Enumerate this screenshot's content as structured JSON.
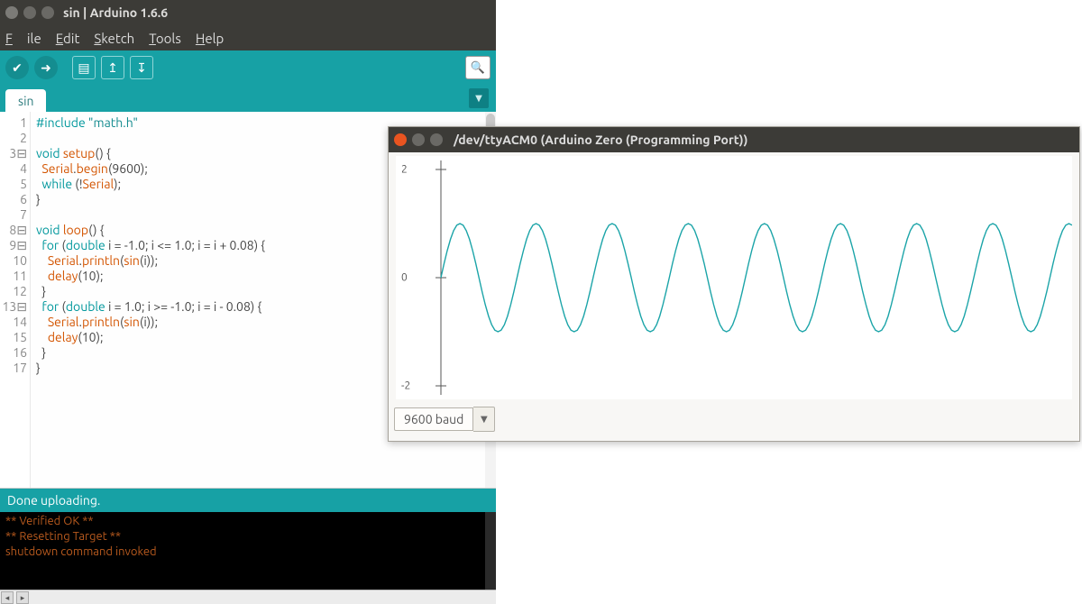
{
  "ide": {
    "title": "sin | Arduino 1.6.6",
    "menu": {
      "file": "File",
      "edit": "Edit",
      "sketch": "Sketch",
      "tools": "Tools",
      "help": "Help"
    },
    "icons": {
      "verify": "✔",
      "upload": "➜",
      "new": "▤",
      "open": "↥",
      "save": "↧",
      "serial": "🔍"
    },
    "tab_label": "sin",
    "gutter": [
      "1",
      "2",
      "3⊟",
      "4",
      "5",
      "6",
      "7",
      "8⊟",
      "9⊟",
      "10",
      "11",
      "12",
      "13⊟",
      "14",
      "15",
      "16",
      "17"
    ],
    "status": "Done uploading.",
    "console": [
      "** Verified OK **",
      "** Resetting Target **",
      "shutdown command invoked"
    ]
  },
  "plotter": {
    "title": "/dev/ttyACM0 (Arduino Zero (Programming Port))",
    "baud": "9600 baud"
  },
  "chart_data": {
    "type": "line",
    "title": "",
    "xlabel": "",
    "ylabel": "",
    "ylim": [
      -2.0,
      2.0
    ],
    "yticks": [
      2.0,
      0.0,
      -2.0
    ],
    "x": [
      0,
      1,
      2,
      3,
      4,
      5,
      6,
      7,
      8,
      9,
      10,
      11,
      12,
      13,
      14,
      15,
      16,
      17,
      18,
      19,
      20,
      21,
      22,
      23,
      24,
      25,
      26,
      27,
      28,
      29,
      30,
      31,
      32,
      33,
      34,
      35,
      36,
      37,
      38,
      39,
      40,
      41,
      42,
      43,
      44,
      45,
      46,
      47,
      48,
      49,
      50,
      51,
      52,
      53,
      54,
      55,
      56,
      57,
      58,
      59,
      60,
      61,
      62,
      63,
      64,
      65,
      66,
      67,
      68,
      69,
      70,
      71,
      72,
      73,
      74,
      75,
      76,
      77,
      78,
      79,
      80,
      81,
      82,
      83,
      84,
      85,
      86,
      87,
      88,
      89,
      90,
      91,
      92,
      93,
      94,
      95,
      96,
      97,
      98,
      99,
      100,
      101,
      102,
      103,
      104,
      105,
      106,
      107,
      108,
      109,
      110,
      111,
      112,
      113,
      114,
      115,
      116,
      117,
      118,
      119,
      120,
      121,
      122,
      123,
      124,
      125,
      126,
      127,
      128,
      129,
      130,
      131,
      132,
      133,
      134,
      135,
      136,
      137,
      138,
      139,
      140,
      141,
      142,
      143,
      144,
      145,
      146,
      147,
      148,
      149,
      150,
      151,
      152,
      153,
      154,
      155,
      156,
      157,
      158,
      159,
      160,
      161,
      162,
      163,
      164,
      165,
      166,
      167,
      168,
      169,
      170,
      171,
      172,
      173,
      174,
      175,
      176,
      177,
      178,
      179,
      180,
      181,
      182,
      183,
      184,
      185,
      186,
      187,
      188,
      189,
      190,
      191,
      192,
      193,
      194,
      195,
      196,
      197,
      198,
      199
    ],
    "series": [
      {
        "name": "sin",
        "values": [
          0.0,
          0.26,
          0.5,
          0.71,
          0.87,
          0.97,
          1.0,
          0.97,
          0.87,
          0.71,
          0.5,
          0.26,
          0.0,
          -0.26,
          -0.5,
          -0.71,
          -0.87,
          -0.97,
          -1.0,
          -0.97,
          -0.87,
          -0.71,
          -0.5,
          -0.26,
          0.0,
          0.26,
          0.5,
          0.71,
          0.87,
          0.97,
          1.0,
          0.97,
          0.87,
          0.71,
          0.5,
          0.26,
          0.0,
          -0.26,
          -0.5,
          -0.71,
          -0.87,
          -0.97,
          -1.0,
          -0.97,
          -0.87,
          -0.71,
          -0.5,
          -0.26,
          0.0,
          0.26,
          0.5,
          0.71,
          0.87,
          0.97,
          1.0,
          0.97,
          0.87,
          0.71,
          0.5,
          0.26,
          0.0,
          -0.26,
          -0.5,
          -0.71,
          -0.87,
          -0.97,
          -1.0,
          -0.97,
          -0.87,
          -0.71,
          -0.5,
          -0.26,
          0.0,
          0.26,
          0.5,
          0.71,
          0.87,
          0.97,
          1.0,
          0.97,
          0.87,
          0.71,
          0.5,
          0.26,
          0.0,
          -0.26,
          -0.5,
          -0.71,
          -0.87,
          -0.97,
          -1.0,
          -0.97,
          -0.87,
          -0.71,
          -0.5,
          -0.26,
          0.0,
          0.26,
          0.5,
          0.71,
          0.87,
          0.97,
          1.0,
          0.97,
          0.87,
          0.71,
          0.5,
          0.26,
          0.0,
          -0.26,
          -0.5,
          -0.71,
          -0.87,
          -0.97,
          -1.0,
          -0.97,
          -0.87,
          -0.71,
          -0.5,
          -0.26,
          0.0,
          0.26,
          0.5,
          0.71,
          0.87,
          0.97,
          1.0,
          0.97,
          0.87,
          0.71,
          0.5,
          0.26,
          0.0,
          -0.26,
          -0.5,
          -0.71,
          -0.87,
          -0.97,
          -1.0,
          -0.97,
          -0.87,
          -0.71,
          -0.5,
          -0.26,
          0.0,
          0.26,
          0.5,
          0.71,
          0.87,
          0.97,
          1.0,
          0.97,
          0.87,
          0.71,
          0.5,
          0.26,
          0.0,
          -0.26,
          -0.5,
          -0.71,
          -0.87,
          -0.97,
          -1.0,
          -0.97,
          -0.87,
          -0.71,
          -0.5,
          -0.26,
          0.0,
          0.26,
          0.5,
          0.71,
          0.87,
          0.97,
          1.0,
          0.97,
          0.87,
          0.71,
          0.5,
          0.26,
          0.0,
          -0.26,
          -0.5,
          -0.71,
          -0.87,
          -0.97,
          -1.0,
          -0.97,
          -0.87,
          -0.71,
          -0.5,
          -0.26,
          0.0,
          0.26,
          0.5,
          0.71,
          0.87,
          0.97,
          1.0,
          0.97
        ]
      }
    ]
  }
}
